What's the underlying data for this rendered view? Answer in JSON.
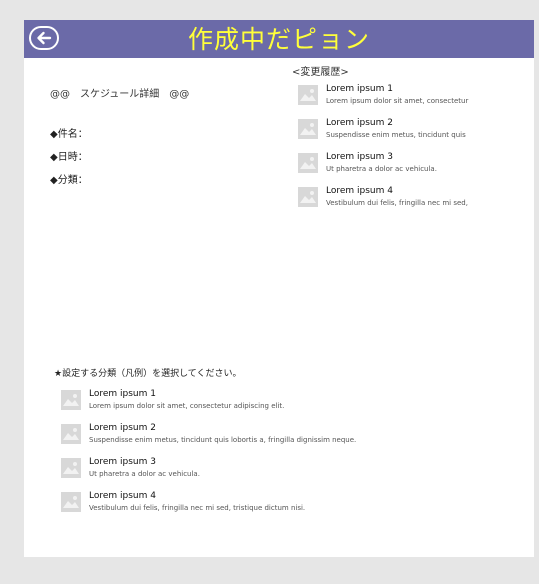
{
  "header": {
    "title": "作成中だピョン"
  },
  "main": {
    "heading": "@@　スケジュール詳細　@@",
    "fields": [
      {
        "label": "◆件名："
      },
      {
        "label": "◆日時："
      },
      {
        "label": "◆分類："
      }
    ]
  },
  "history": {
    "title": "<変更履歴>",
    "items": [
      {
        "title": "Lorem ipsum 1",
        "subtitle": "Lorem ipsum dolor sit amet, consectetur"
      },
      {
        "title": "Lorem ipsum 2",
        "subtitle": "Suspendisse enim metus, tincidunt quis"
      },
      {
        "title": "Lorem ipsum 3",
        "subtitle": "Ut pharetra a dolor ac vehicula."
      },
      {
        "title": "Lorem ipsum 4",
        "subtitle": "Vestibulum dui felis, fringilla nec mi sed,"
      }
    ]
  },
  "legend": {
    "title": "★設定する分類（凡例）を選択してください。",
    "items": [
      {
        "title": "Lorem ipsum 1",
        "subtitle": "Lorem ipsum dolor sit amet, consectetur adipiscing elit."
      },
      {
        "title": "Lorem ipsum 2",
        "subtitle": "Suspendisse enim metus, tincidunt quis lobortis a, fringilla dignissim neque."
      },
      {
        "title": "Lorem ipsum 3",
        "subtitle": "Ut pharetra a dolor ac vehicula."
      },
      {
        "title": "Lorem ipsum 4",
        "subtitle": "Vestibulum dui felis, fringilla nec mi sed, tristique dictum nisi."
      }
    ]
  },
  "icons": {
    "back": "back-arrow-icon",
    "thumbnail": "image-placeholder-icon"
  },
  "colors": {
    "titlebar": "#6b6aa8",
    "title_text": "#ffff3a",
    "background": "#e6e6e6",
    "thumbnail": "#d8d8d8"
  }
}
